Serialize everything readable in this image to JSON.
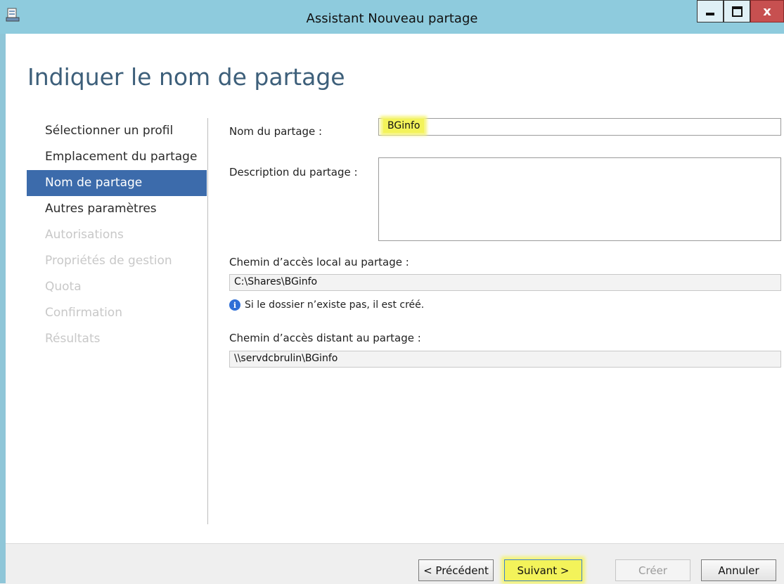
{
  "window": {
    "title": "Assistant Nouveau partage",
    "close_glyph": "x"
  },
  "page": {
    "heading": "Indiquer le nom de partage"
  },
  "sidebar": {
    "items": [
      {
        "label": "Sélectionner un profil",
        "state": "normal"
      },
      {
        "label": "Emplacement du partage",
        "state": "normal"
      },
      {
        "label": "Nom de partage",
        "state": "active"
      },
      {
        "label": "Autres paramètres",
        "state": "normal"
      },
      {
        "label": "Autorisations",
        "state": "disabled"
      },
      {
        "label": "Propriétés de gestion",
        "state": "disabled"
      },
      {
        "label": "Quota",
        "state": "disabled"
      },
      {
        "label": "Confirmation",
        "state": "disabled"
      },
      {
        "label": "Résultats",
        "state": "disabled"
      }
    ]
  },
  "form": {
    "share_name_label": "Nom du partage :",
    "share_name_value": "BGinfo",
    "description_label": "Description du partage :",
    "description_value": "",
    "local_path_label": "Chemin d’accès local au partage :",
    "local_path_value": "C:\\Shares\\BGinfo",
    "info_message": "Si le dossier n’existe pas, il est créé.",
    "remote_path_label": "Chemin d’accès distant au partage :",
    "remote_path_value": "\\\\servdcbrulin\\BGinfo"
  },
  "buttons": {
    "previous": "< Précédent",
    "next": "Suivant >",
    "create": "Créer",
    "cancel": "Annuler"
  },
  "colors": {
    "titlebar": "#8ecbdd",
    "active_item": "#3c6bab",
    "heading": "#3d5f7a",
    "highlight": "#f3f35a"
  }
}
